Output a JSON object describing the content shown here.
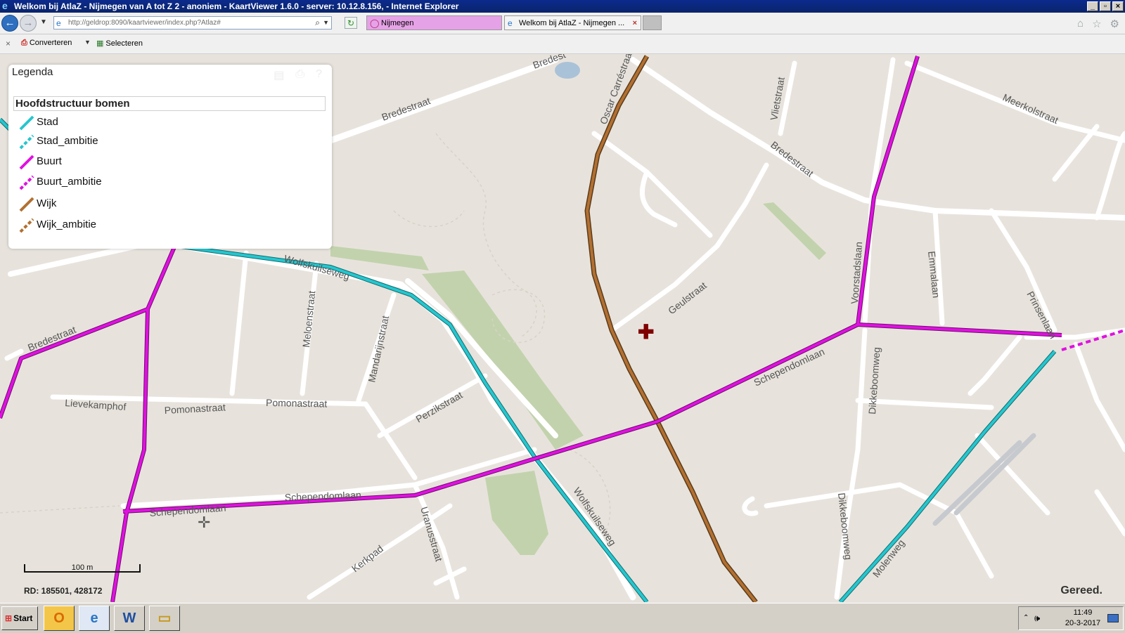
{
  "window": {
    "title": "Welkom bij AtlaZ - Nijmegen van A tot Z 2 - anoniem - KaartViewer 1.6.0 - server: 10.12.8.156,  - Internet Explorer",
    "controls": [
      "_",
      "▫",
      "×"
    ]
  },
  "browser": {
    "address_url": "http://geldrop:8090/kaartviewer/index.php?Atlaz#",
    "tabs": [
      {
        "label": "Nijmegen",
        "active": false,
        "color": "#e6a2e6"
      },
      {
        "label": "Welkom bij AtlaZ - Nijmegen ...",
        "active": true
      }
    ]
  },
  "commandbar": {
    "convert_label": "Converteren",
    "select_label": "Selecteren"
  },
  "legend": {
    "title": "Legenda",
    "group": "Hoofdstructuur bomen",
    "items": [
      {
        "label": "Stad",
        "color": "#26c6ce",
        "style": "solid"
      },
      {
        "label": "Stad_ambitie",
        "color": "#26c6ce",
        "style": "dashed"
      },
      {
        "label": "Buurt",
        "color": "#e011e0",
        "style": "solid"
      },
      {
        "label": "Buurt_ambitie",
        "color": "#e011e0",
        "style": "dashed"
      },
      {
        "label": "Wijk",
        "color": "#b06c2c",
        "style": "solid"
      },
      {
        "label": "Wijk_ambitie",
        "color": "#b06c2c",
        "style": "dashed"
      }
    ]
  },
  "map": {
    "streets": {
      "bredestraat_n": "Bredestraat",
      "bredestraat_top": "Bredest",
      "oscar_carre": "Oscar Carréstraat",
      "vlietstraat": "Vlietstraat",
      "bredestraat_e": "Bredestraat",
      "meerkolstraat": "Meerkolstraat",
      "wolfskuilseweg": "Wolfskuilseweg",
      "meloenstraat": "Meloenstraat",
      "mandarijnstraat": "Mandarijnstraat",
      "geulstraat": "Geulstraat",
      "voorstadslaan": "Voorstadslaan",
      "emmalaan": "Emmalaan",
      "prinsenlaan": "Prinsenlaan",
      "bredestraat_w": "Bredestraat",
      "lievekamphof": "Lievekamphof",
      "pomonastraat_1": "Pomonastraat",
      "pomonastraat_2": "Pomonastraat",
      "perzikstraat": "Perzikstraat",
      "schependomlaan_e": "Schependomlaan",
      "dikkeboomweg_1": "Dikkeboomweg",
      "schependomlaan_w": "Schependomlaan",
      "schependomlaan_w2": "Schependomlaan",
      "uranusstraat": "Uranusstraat",
      "wolfskuilseweg_s": "Wolfskuilseweg",
      "kerkpad": "Kerkpad",
      "dikkeboomweg_2": "Dikkeboomweg",
      "molenweg": "Molenweg"
    },
    "scale_label": "100 m",
    "coordinates": "RD: 185501, 428172",
    "status": "Gereed."
  },
  "taskbar": {
    "start_label": "Start",
    "time": "11:49",
    "date": "20-3-2017"
  }
}
